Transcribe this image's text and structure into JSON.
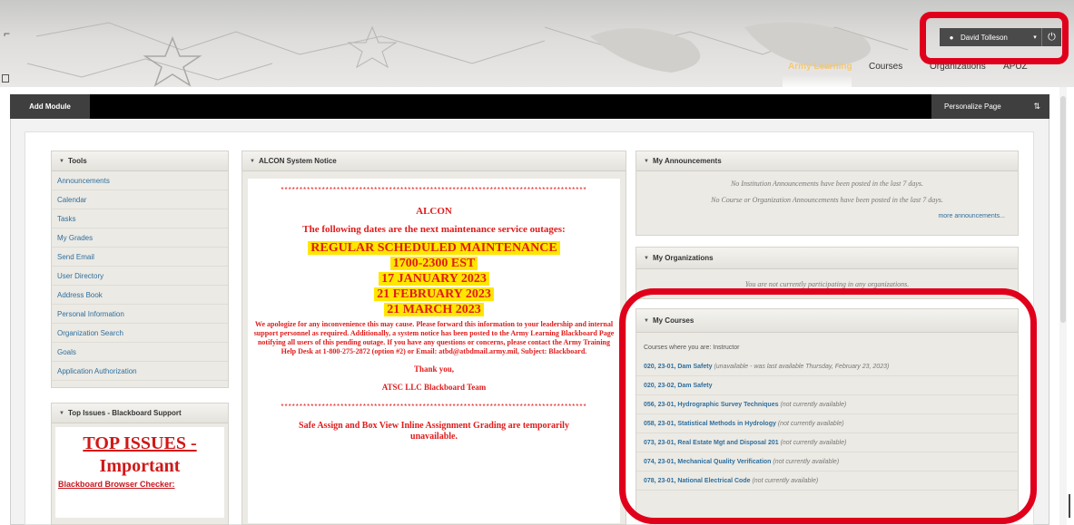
{
  "header": {
    "user_name": "David Tolleson",
    "nav": [
      "Army Learning",
      "Courses",
      "Organizations",
      "APUZ"
    ]
  },
  "toolbar": {
    "add_module": "Add Module",
    "personalize": "Personalize Page",
    "reorder_glyph": "⇅"
  },
  "tools": {
    "title": "Tools",
    "items": [
      "Announcements",
      "Calendar",
      "Tasks",
      "My Grades",
      "Send Email",
      "User Directory",
      "Address Book",
      "Personal Information",
      "Organization Search",
      "Goals",
      "Application Authorization"
    ]
  },
  "top_issues": {
    "title": "Top Issues - Blackboard Support",
    "heading_line1": "TOP ISSUES -",
    "heading_line2": "Important",
    "link": "Blackboard Browser Checker:"
  },
  "alcon": {
    "title": "ALCON System Notice",
    "heading": "ALCON",
    "intro": "The following dates are the next maintenance service outages:",
    "lines": [
      "REGULAR SCHEDULED MAINTENANCE",
      "1700-2300 EST",
      "17 JANUARY 2023",
      "21 FEBRUARY 2023",
      "21 MARCH 2023"
    ],
    "body": "We apologize for any inconvenience this may cause. Please forward this information to your leadership and internal support personnel as required. Additionally, a system notice has been posted to the Army Learning Blackboard Page notifying all users of this pending outage. If you have any questions or concerns, please contact the Army Training Help Desk at 1-800-275-2872 (option #2) or Email: atbd@atbdmail.army.mil, Subject: Blackboard.",
    "thanks": "Thank you,",
    "team": "ATSC LLC Blackboard Team",
    "footer": "Safe Assign and Box View Inline Assignment Grading are temporarily unavailable."
  },
  "announcements": {
    "title": "My Announcements",
    "line1": "No Institution Announcements have been posted in the last 7 days.",
    "line2": "No Course or Organization Announcements have been posted in the last 7 days.",
    "more": "more announcements..."
  },
  "organizations": {
    "title": "My Organizations",
    "line": "You are not currently participating in any organizations."
  },
  "courses": {
    "title": "My Courses",
    "intro": "Courses where you are: Instructor",
    "items": [
      {
        "name": "020, 23-01, Dam Safety",
        "status": "(unavailable - was last available Thursday, February 23, 2023)"
      },
      {
        "name": "020, 23-02, Dam Safety",
        "status": ""
      },
      {
        "name": "056, 23-01, Hydrographic Survey Techniques",
        "status": "(not currently available)"
      },
      {
        "name": "058, 23-01, Statistical Methods in Hydrology",
        "status": "(not currently available)"
      },
      {
        "name": "073, 23-01, Real Estate Mgt and Disposal 201",
        "status": "(not currently available)"
      },
      {
        "name": "074, 23-01, Mechanical Quality Verification",
        "status": "(not currently available)"
      },
      {
        "name": "078, 23-01, National Electrical Code",
        "status": "(not currently available)"
      }
    ]
  },
  "colors": {
    "highlight": "#e0001b",
    "link": "#2f6f9e",
    "notice_red": "#e01b1b",
    "notice_yellow": "#ffe600"
  }
}
